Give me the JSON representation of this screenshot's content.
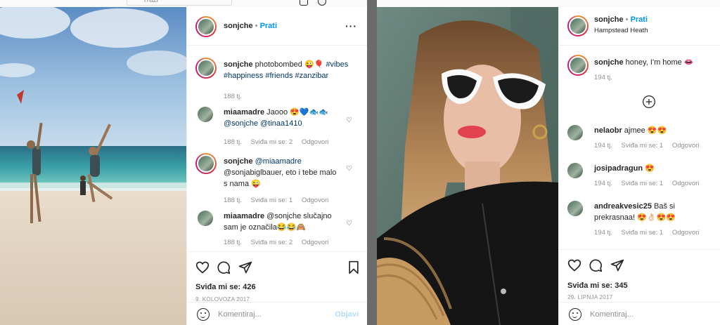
{
  "topbar": {
    "search_placeholder": "Traži"
  },
  "post1": {
    "username": "sonjche",
    "follow": "Prati",
    "caption": {
      "username": "sonjche",
      "text": "photobombed 😜🎈",
      "tags_line1": "#vibes",
      "tags_line2": "#happiness #friends #zanzibar",
      "time": "188 tj."
    },
    "comments": [
      {
        "username": "miaamadre",
        "text": "Jaooo 😍💙🐟🐟",
        "text2": "@sonjche @tinaa1410",
        "time": "188 tj.",
        "likes": "Sviđa mi se: 2",
        "reply": "Odgovori"
      },
      {
        "username": "sonjche",
        "text": "@miaamadre",
        "text2": "@sonjabiglbauer, eto i tebe malo",
        "text3": "s nama 😜",
        "time": "188 tj.",
        "likes": "Sviđa mi se: 1",
        "reply": "Odgovori"
      },
      {
        "username": "miaamadre",
        "text": "@sonjche slučajno",
        "text2": "sam je označila😂😂🙈",
        "time": "188 tj.",
        "likes": "Sviđa mi se: 2",
        "reply": "Odgovori"
      }
    ],
    "likes": "Sviđa mi se: 426",
    "date": "9. KOLOVOZA 2017",
    "composer_placeholder": "Komentiraj...",
    "post_button": "Objavi"
  },
  "post2": {
    "username": "sonjche",
    "follow": "Prati",
    "location": "Hampstead Heath",
    "caption": {
      "username": "sonjche",
      "text": "honey, I'm home 👄",
      "time": "194 tj."
    },
    "comments": [
      {
        "username": "nelaobr",
        "text": "ajmee 😍😍",
        "time": "194 tj.",
        "likes": "Sviđa mi se: 1",
        "reply": "Odgovori"
      },
      {
        "username": "josipadragun",
        "text": "😍",
        "time": "194 tj.",
        "likes": "Sviđa mi se: 1",
        "reply": "Odgovori"
      },
      {
        "username": "andreakvesic25",
        "text": "Baš si",
        "text2": "prekrasnaa! 😍👌🏻😍😍",
        "time": "194 tj.",
        "likes": "Sviđa mi se: 1",
        "reply": "Odgovori"
      }
    ],
    "likes": "Sviđa mi se: 345",
    "date": "29. LIPNJA 2017",
    "composer_placeholder": "Komentiraj..."
  }
}
